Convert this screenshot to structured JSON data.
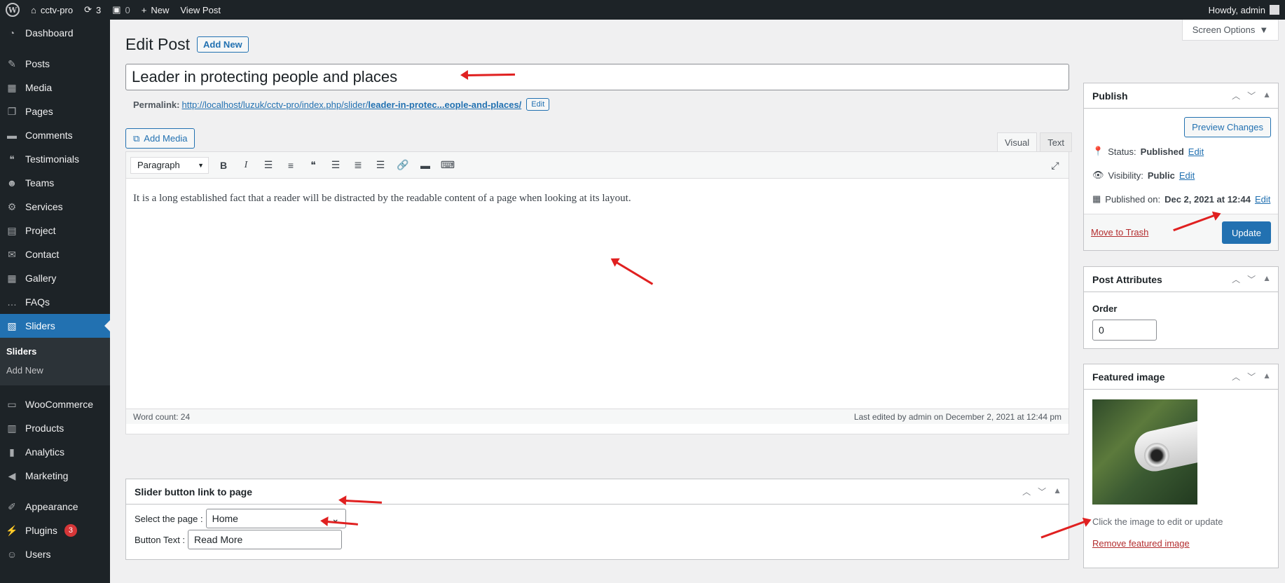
{
  "adminbar": {
    "site_name": "cctv-pro",
    "updates_count": "3",
    "comments_count": "0",
    "new_label": "New",
    "view_post_label": "View Post",
    "howdy": "Howdy, admin"
  },
  "sidebar": {
    "items": [
      {
        "label": "Dashboard",
        "icon": "dashboard-icon"
      },
      {
        "label": "Posts",
        "icon": "pin-icon"
      },
      {
        "label": "Media",
        "icon": "media-icon"
      },
      {
        "label": "Pages",
        "icon": "pages-icon"
      },
      {
        "label": "Comments",
        "icon": "comment-icon"
      },
      {
        "label": "Testimonials",
        "icon": "testimonial-icon"
      },
      {
        "label": "Teams",
        "icon": "groups-icon"
      },
      {
        "label": "Services",
        "icon": "services-icon"
      },
      {
        "label": "Project",
        "icon": "project-icon"
      },
      {
        "label": "Contact",
        "icon": "mail-icon"
      },
      {
        "label": "Gallery",
        "icon": "gallery-icon"
      },
      {
        "label": "FAQs",
        "icon": "faq-icon"
      },
      {
        "label": "Sliders",
        "icon": "slider-icon"
      },
      {
        "label": "WooCommerce",
        "icon": "woo-icon"
      },
      {
        "label": "Products",
        "icon": "products-icon"
      },
      {
        "label": "Analytics",
        "icon": "analytics-icon"
      },
      {
        "label": "Marketing",
        "icon": "megaphone-icon"
      },
      {
        "label": "Appearance",
        "icon": "brush-icon"
      },
      {
        "label": "Plugins",
        "icon": "plugin-icon",
        "badge": "3"
      },
      {
        "label": "Users",
        "icon": "user-icon"
      }
    ],
    "submenu": [
      "Sliders",
      "Add New"
    ]
  },
  "screen_options": "Screen Options",
  "page": {
    "title": "Edit Post",
    "add_new": "Add New"
  },
  "post": {
    "title": "Leader in protecting people and places",
    "permalink_label": "Permalink:",
    "permalink_base": "http://localhost/luzuk/cctv-pro/index.php/slider/",
    "permalink_slug": "leader-in-protec...eople-and-places/",
    "permalink_edit": "Edit"
  },
  "editor": {
    "add_media": "Add Media",
    "tab_visual": "Visual",
    "tab_text": "Text",
    "format": "Paragraph",
    "content": "It is a long established fact that a reader will be distracted by the readable content of a page when looking at its layout.",
    "word_count": "Word count: 24",
    "last_edited": "Last edited by admin on December 2, 2021 at 12:44 pm"
  },
  "slider_box": {
    "title": "Slider button link to page",
    "select_label": "Select the page :",
    "select_value": "Home",
    "button_text_label": "Button Text :",
    "button_text_value": "Read More"
  },
  "publish": {
    "title": "Publish",
    "preview": "Preview Changes",
    "status_label": "Status:",
    "status_value": "Published",
    "visibility_label": "Visibility:",
    "visibility_value": "Public",
    "published_label": "Published on:",
    "published_value": "Dec 2, 2021 at 12:44",
    "edit": "Edit",
    "trash": "Move to Trash",
    "update": "Update"
  },
  "attributes": {
    "title": "Post Attributes",
    "order_label": "Order",
    "order_value": "0"
  },
  "featured": {
    "title": "Featured image",
    "hint": "Click the image to edit or update",
    "remove": "Remove featured image"
  },
  "colors": {
    "accent": "#2271b1",
    "adminbar": "#1d2327",
    "annotation": "#e02020"
  }
}
